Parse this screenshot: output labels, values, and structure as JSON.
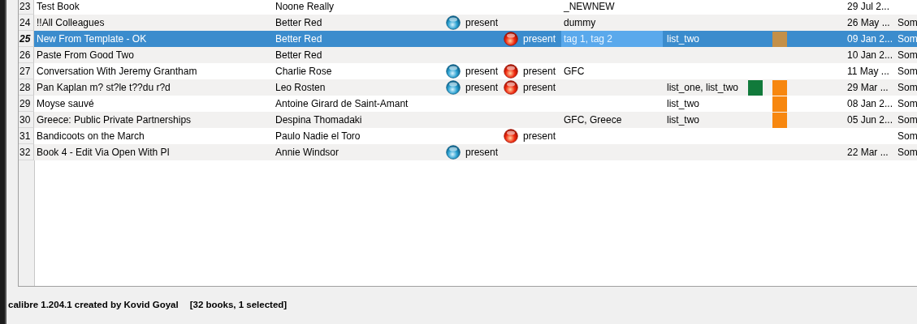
{
  "table": {
    "rows": [
      {
        "number": "23",
        "title": "Test Book",
        "author": "Noone Really",
        "tags": "_NEWNEW",
        "date": "29 Jul 2...",
        "selected": false
      },
      {
        "number": "24",
        "title": "!!All Colleagues",
        "author": "Better Red",
        "column_5": "present",
        "tags": "dummy",
        "date": "26 May ...",
        "column_last": "Som",
        "selected": false
      },
      {
        "number": "25",
        "title": "New From Template - OK",
        "author": "Better Red",
        "column_6": "present",
        "tags": "tag 1, tag 2",
        "lists": "list_two",
        "swatch_b": {
          "color": "#c49048"
        },
        "date": "09 Jan 2...",
        "column_last": "Som",
        "selected": true
      },
      {
        "number": "26",
        "title": "Paste From Good Two",
        "author": "Better Red",
        "date": "10 Jan 2...",
        "column_last": "Som",
        "selected": false
      },
      {
        "number": "27",
        "title": "Conversation With Jeremy Grantham",
        "author": "Charlie Rose",
        "column_5": "present",
        "column_6": "present",
        "tags": "GFC",
        "date": "11 May ...",
        "column_last": "Som",
        "selected": false
      },
      {
        "number": "28",
        "title": "Pan Kaplan m? st?le t??du r?d",
        "author": "Leo Rosten",
        "column_5": "present",
        "column_6": "present",
        "lists": "list_one, list_two",
        "swatch_a": {
          "color": "#117a3b"
        },
        "swatch_b": {
          "color": "#f7870f"
        },
        "date": "29 Mar ...",
        "column_last": "Som",
        "selected": false
      },
      {
        "number": "29",
        "title": "Moyse sauvé",
        "author": "Antoine Girard de Saint-Amant",
        "lists": "list_two",
        "swatch_b": {
          "color": "#f7870f"
        },
        "date": "08 Jan 2...",
        "column_last": "Som",
        "selected": false
      },
      {
        "number": "30",
        "title": "Greece: Public Private Partnerships",
        "author": "Despina Thomadaki",
        "tags": "GFC, Greece",
        "lists": "list_two",
        "swatch_b": {
          "color": "#f7870f"
        },
        "date": "05 Jun 2...",
        "column_last": "Som",
        "selected": false
      },
      {
        "number": "31",
        "title": "Bandicoots on the March",
        "author": "Paulo Nadie el Toro",
        "column_6": "present",
        "column_last": "Som",
        "selected": false
      },
      {
        "number": "32",
        "title": "Book 4 - Edit Via Open With PI",
        "author": "Annie Windsor",
        "column_5": "present",
        "date": "22 Mar ...",
        "column_last": "Som",
        "selected": false
      }
    ]
  },
  "status_bar": {
    "version": "calibre 1.204.1 created by Kovid Goyal",
    "summary": "[32 books, 1 selected]"
  }
}
